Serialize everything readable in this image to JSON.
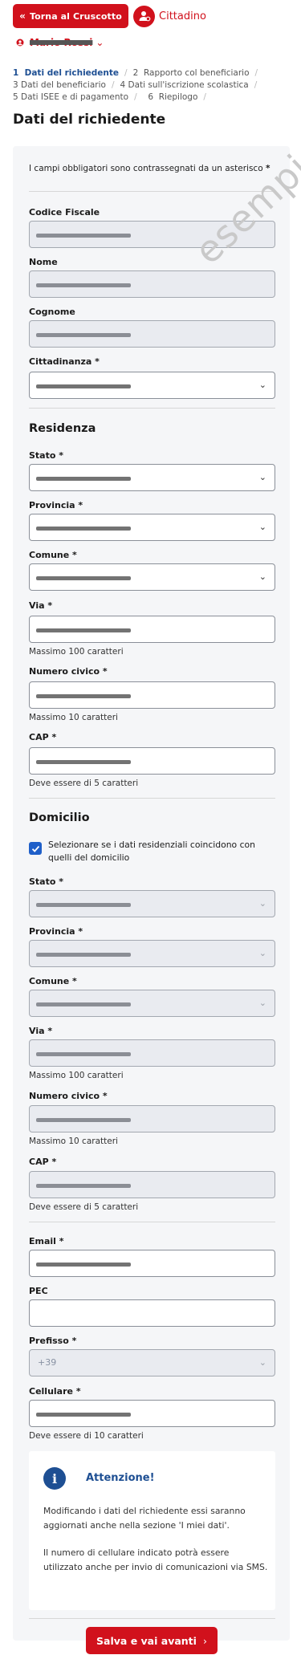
{
  "header": {
    "back_label": "Torna al Cruscotto",
    "role_label": "Cittadino",
    "user_name": "Mario Rossi"
  },
  "steps": [
    {
      "num": "1",
      "label": "Dati del richiedente",
      "active": true
    },
    {
      "num": "2",
      "label": "Rapporto col beneficiario"
    },
    {
      "num": "3",
      "label": "Dati del beneficiario"
    },
    {
      "num": "4",
      "label": "Dati sull'iscrizione scolastica"
    },
    {
      "num": "5",
      "label": "Dati ISEE e di pagamento"
    },
    {
      "num": "6",
      "label": "Riepilogo"
    }
  ],
  "page_title": "Dati del richiedente",
  "watermark": "esempio",
  "form": {
    "required_note": "I campi obbligatori sono contrassegnati da un asterisco",
    "required_mark": "*",
    "codice_fiscale": "Codice Fiscale",
    "nome": "Nome",
    "cognome": "Cognome",
    "cittadinanza": "Cittadinanza *",
    "residenza_title": "Residenza",
    "res_stato": "Stato *",
    "res_provincia": "Provincia *",
    "res_comune": "Comune *",
    "res_via": "Via *",
    "res_via_hint": "Massimo 100 caratteri",
    "res_civico": "Numero civico *",
    "res_civico_hint": "Massimo 10 caratteri",
    "res_cap": "CAP *",
    "res_cap_hint": "Deve essere di 5 caratteri",
    "domicilio_title": "Domicilio",
    "domicilio_check": "Selezionare se i dati residenziali coincidono con quelli del domicilio",
    "dom_stato": "Stato *",
    "dom_provincia": "Provincia *",
    "dom_comune": "Comune *",
    "dom_via": "Via *",
    "dom_via_hint": "Massimo 100 caratteri",
    "dom_civico": "Numero civico *",
    "dom_civico_hint": "Massimo 10 caratteri",
    "dom_cap": "CAP *",
    "dom_cap_hint": "Deve essere di 5 caratteri",
    "email": "Email *",
    "pec": "PEC",
    "prefisso": "Prefisso *",
    "prefisso_value": "+39",
    "cellulare": "Cellulare *",
    "cellulare_hint": "Deve essere di 10 caratteri"
  },
  "alert": {
    "title": "Attenzione!",
    "p1": "Modificando i dati del richiedente essi saranno aggiornati anche nella sezione 'I miei dati'.",
    "p2": "Il numero di cellulare indicato potrà essere utilizzato anche per invio di comunicazioni via SMS."
  },
  "save_label": "Salva e vai avanti",
  "colors": {
    "primary": "#d1111c",
    "accent": "#1e4f93",
    "checkbox": "#1f5fc9"
  }
}
